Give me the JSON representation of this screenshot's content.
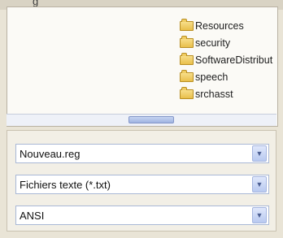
{
  "header": {
    "partial_text": "g"
  },
  "folders": [
    {
      "name": "Resources",
      "icon": "folder-icon"
    },
    {
      "name": "security",
      "icon": "folder-icon"
    },
    {
      "name": "SoftwareDistribut",
      "icon": "folder-icon"
    },
    {
      "name": "speech",
      "icon": "folder-icon"
    },
    {
      "name": "srchasst",
      "icon": "folder-icon"
    }
  ],
  "file_name": {
    "value": "Nouveau.reg"
  },
  "file_type": {
    "value": "Fichiers texte (*.txt)"
  },
  "encoding": {
    "value": "ANSI"
  },
  "colors": {
    "background": "#e9e4d6",
    "pane": "#fbfaf6",
    "folder": "#e9bf4b",
    "combo_border": "#a9b8d6",
    "scroll_thumb": "#9fb3e0"
  }
}
